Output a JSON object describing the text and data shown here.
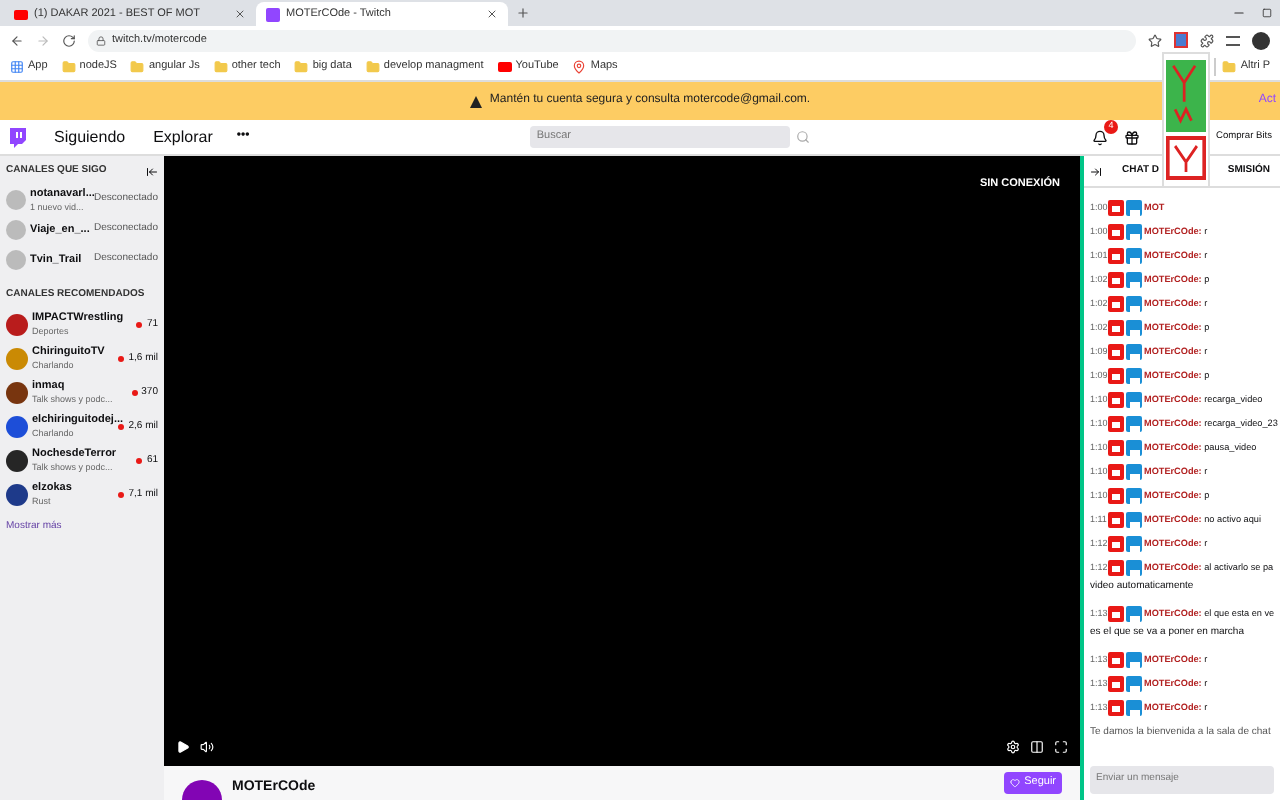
{
  "browser": {
    "tabs": [
      {
        "title": "(1) DAKAR 2021 - BEST OF MOT",
        "kind": "youtube",
        "selected": false
      },
      {
        "title": "MOTErCOde - Twitch",
        "kind": "twitch",
        "selected": true
      }
    ],
    "address": "twitch.tv/motercode",
    "bookmarks": [
      {
        "label": "App",
        "kind": "apps"
      },
      {
        "label": "nodeJS",
        "kind": "folder"
      },
      {
        "label": "angular Js",
        "kind": "folder"
      },
      {
        "label": "other tech",
        "kind": "folder"
      },
      {
        "label": "big data",
        "kind": "folder"
      },
      {
        "label": "develop managment",
        "kind": "folder"
      },
      {
        "label": "YouTube",
        "kind": "youtube"
      },
      {
        "label": "Maps",
        "kind": "maps"
      }
    ],
    "other_bookmarks": "Altri P"
  },
  "banner": {
    "text": "Mantén tu cuenta segura y consulta motercode@gmail.com.",
    "action": "Act"
  },
  "nav": {
    "links": [
      "Siguiendo",
      "Explorar"
    ],
    "more": "•••",
    "search": {
      "placeholder": "Buscar"
    },
    "notifications": "4",
    "bits": "Comprar Bits"
  },
  "sidebar": {
    "followed_title": "CANALES QUE SIGO",
    "followed": [
      {
        "name": "notanavarl...",
        "sub": "1 nuevo vid...",
        "status": "Desconectado"
      },
      {
        "name": "Viaje_en_...",
        "status": "Desconectado"
      },
      {
        "name": "Tvin_Trail",
        "status": "Desconectado"
      }
    ],
    "recommended_title": "CANALES RECOMENDADOS",
    "recommended": [
      {
        "name": "IMPACTWrestling",
        "category": "Deportes",
        "viewers": "71",
        "color": "#b91c1c"
      },
      {
        "name": "ChiringuitoTV",
        "category": "Charlando",
        "viewers": "1,6 mil",
        "color": "#ca8a04"
      },
      {
        "name": "inmaq",
        "category": "Talk shows y podc...",
        "viewers": "370",
        "color": "#78350f"
      },
      {
        "name": "elchiringuitodej...",
        "category": "Charlando",
        "viewers": "2,6 mil",
        "color": "#1d4ed8"
      },
      {
        "name": "NochesdeTerror",
        "category": "Talk shows y podc...",
        "viewers": "61",
        "color": "#262626"
      },
      {
        "name": "elzokas",
        "category": "Rust",
        "viewers": "7,1 mil",
        "color": "#1e3a8a"
      }
    ],
    "more": "Mostrar más"
  },
  "player": {
    "status": "SIN CONEXIÓN",
    "channel": "MOTErCOde",
    "follow": "Seguir"
  },
  "chat": {
    "title_start": "CHAT D",
    "title_end": "SMISIÓN",
    "messages": [
      {
        "time": "1:00",
        "author": "MOT"
      },
      {
        "time": "1:00",
        "author": "MOTErCOde:",
        "text": "r"
      },
      {
        "time": "1:01",
        "author": "MOTErCOde:",
        "text": "r"
      },
      {
        "time": "1:02",
        "author": "MOTErCOde:",
        "text": "p"
      },
      {
        "time": "1:02",
        "author": "MOTErCOde:",
        "text": "r"
      },
      {
        "time": "1:02",
        "author": "MOTErCOde:",
        "text": "p"
      },
      {
        "time": "1:09",
        "author": "MOTErCOde:",
        "text": "r"
      },
      {
        "time": "1:09",
        "author": "MOTErCOde:",
        "text": "p"
      },
      {
        "time": "1:10",
        "author": "MOTErCOde:",
        "text": "recarga_video"
      },
      {
        "time": "1:10",
        "author": "MOTErCOde:",
        "text": "recarga_video_23"
      },
      {
        "time": "1:10",
        "author": "MOTErCOde:",
        "text": "pausa_video"
      },
      {
        "time": "1:10",
        "author": "MOTErCOde:",
        "text": "r"
      },
      {
        "time": "1:10",
        "author": "MOTErCOde:",
        "text": "p"
      },
      {
        "time": "1:11",
        "author": "MOTErCOde:",
        "text": "no activo aqui"
      },
      {
        "time": "1:12",
        "author": "MOTErCOde:",
        "text": "r"
      },
      {
        "time": "1:12",
        "author": "MOTErCOde:",
        "text": "al activarlo se pa",
        "continuation": "video automaticamente"
      },
      {
        "time": "1:13",
        "author": "MOTErCOde:",
        "text": "el que esta en ve",
        "continuation": "es el que se va a poner en marcha"
      },
      {
        "time": "1:13",
        "author": "MOTErCOde:",
        "text": "r"
      },
      {
        "time": "1:13",
        "author": "MOTErCOde:",
        "text": "r"
      },
      {
        "time": "1:13",
        "author": "MOTErCOde:",
        "text": "r"
      }
    ],
    "welcome": "Te damos la bienvenida a la sala de chat",
    "input": {
      "placeholder": "Enviar un mensaje"
    }
  }
}
